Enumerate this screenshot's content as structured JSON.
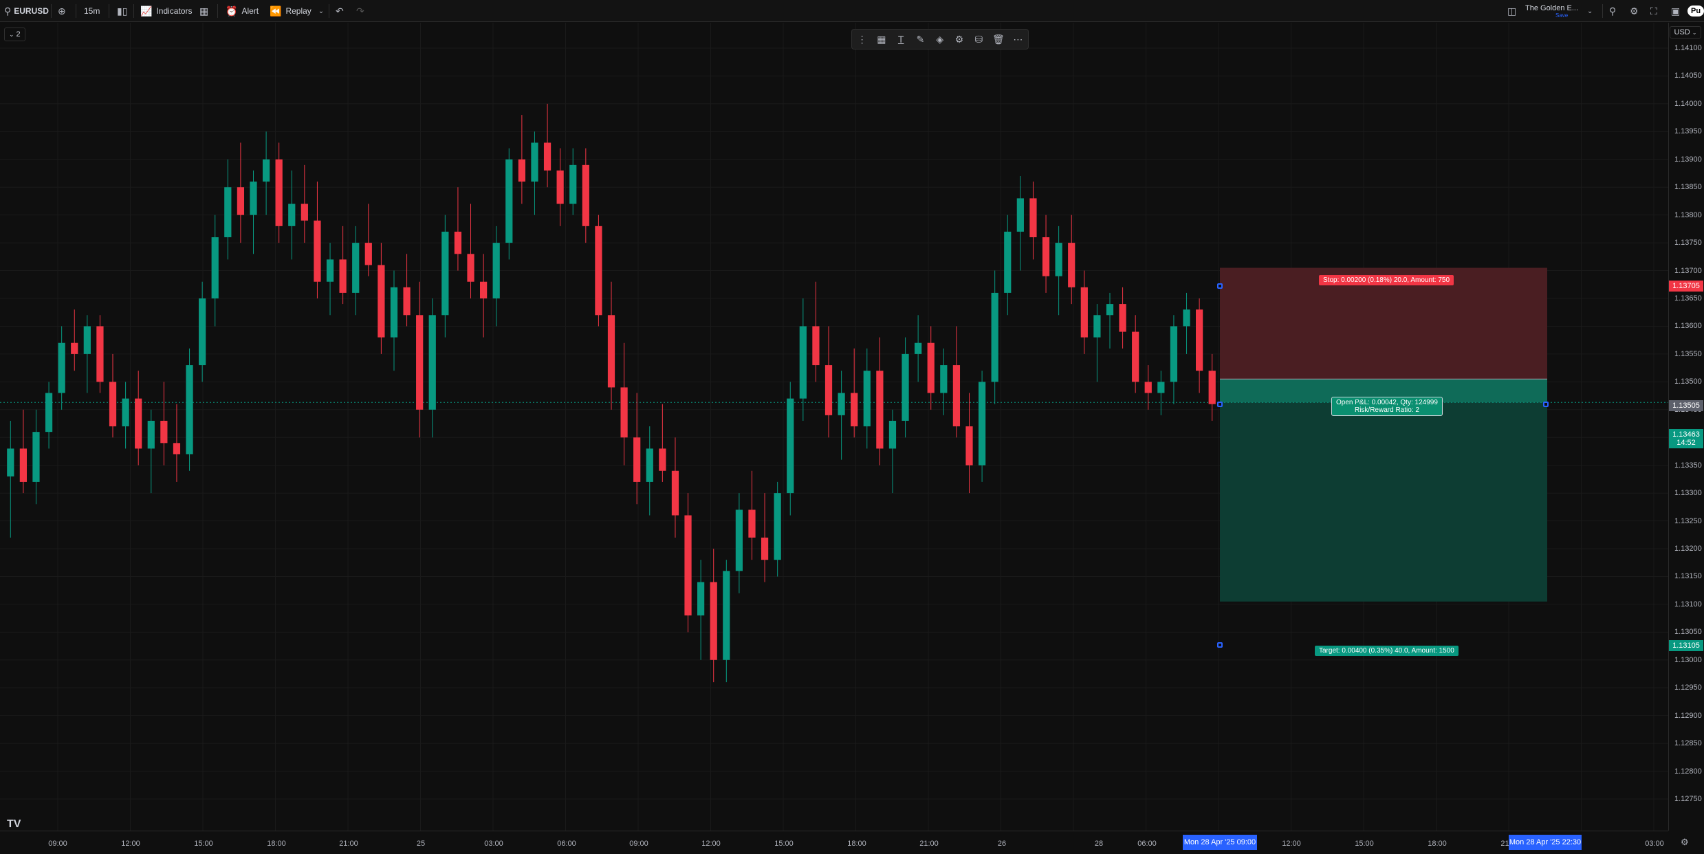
{
  "toolbar": {
    "symbol": "EURUSD",
    "interval": "15m",
    "indicators": "Indicators",
    "alert": "Alert",
    "replay": "Replay",
    "layout_name": "The Golden E...",
    "save": "Save",
    "account_badge": "Pu"
  },
  "layout_badge": "2",
  "currency": "USD",
  "floating_toolbar_icons": [
    "drag-handle-icon",
    "template-icon",
    "text-tool-icon",
    "paint-brush-icon",
    "fill-color-icon",
    "settings-icon",
    "lock-icon",
    "trash-icon",
    "more-icon"
  ],
  "price_axis": {
    "ticks": [
      "1.14100",
      "1.14050",
      "1.14000",
      "1.13950",
      "1.13900",
      "1.13850",
      "1.13800",
      "1.13750",
      "1.13700",
      "1.13650",
      "1.13600",
      "1.13550",
      "1.13500",
      "1.13450",
      "1.13400",
      "1.13350",
      "1.13300",
      "1.13250",
      "1.13200",
      "1.13150",
      "1.13100",
      "1.13050",
      "1.13000",
      "1.12950",
      "1.12900",
      "1.12850",
      "1.12800",
      "1.12750"
    ],
    "stop_label": "1.13705",
    "entry_label": "1.13505",
    "current_price": "1.13463",
    "countdown": "14:52",
    "target_label": "1.13105"
  },
  "time_axis": {
    "ticks": [
      "09:00",
      "12:00",
      "15:00",
      "18:00",
      "21:00",
      "25",
      "03:00",
      "06:00",
      "09:00",
      "12:00",
      "15:00",
      "18:00",
      "21:00",
      "26",
      "28",
      "06:00",
      "12:00",
      "15:00",
      "18:00",
      "21:",
      "03:00"
    ],
    "start_label": "Mon 28 Apr '25   09:00",
    "end_label": "Mon 28 Apr '25   22:30"
  },
  "position": {
    "stop_text": "Stop: 0.00200 (0.18%) 20.0, Amount: 750",
    "target_text": "Target: 0.00400 (0.35%) 40.0, Amount: 1500",
    "pnl_text": "Open P&L: 0.00042, Qty: 124999",
    "rr_text": "Risk/Reward Ratio: 2",
    "stop": 1.13705,
    "entry": 1.13505,
    "target": 1.13105
  },
  "colors": {
    "up": "#089981",
    "down": "#f23645",
    "stop_zone": "#4a1e22",
    "target_zone": "#0d3d33",
    "accent": "#2962ff"
  },
  "chart_data": {
    "type": "candlestick",
    "ylim": [
      1.1275,
      1.1412
    ],
    "ohlc": [
      [
        1.1333,
        1.1343,
        1.1322,
        1.1338
      ],
      [
        1.1338,
        1.1345,
        1.133,
        1.1332
      ],
      [
        1.1332,
        1.1345,
        1.1328,
        1.1341
      ],
      [
        1.1341,
        1.135,
        1.1338,
        1.1348
      ],
      [
        1.1348,
        1.136,
        1.1345,
        1.1357
      ],
      [
        1.1357,
        1.1363,
        1.1352,
        1.1355
      ],
      [
        1.1355,
        1.1362,
        1.1348,
        1.136
      ],
      [
        1.136,
        1.1362,
        1.1348,
        1.135
      ],
      [
        1.135,
        1.1355,
        1.134,
        1.1342
      ],
      [
        1.1342,
        1.135,
        1.1338,
        1.1347
      ],
      [
        1.1347,
        1.1352,
        1.1335,
        1.1338
      ],
      [
        1.1338,
        1.1345,
        1.133,
        1.1343
      ],
      [
        1.1343,
        1.135,
        1.1335,
        1.1339
      ],
      [
        1.1339,
        1.1346,
        1.1332,
        1.1337
      ],
      [
        1.1337,
        1.1356,
        1.1334,
        1.1353
      ],
      [
        1.1353,
        1.1368,
        1.135,
        1.1365
      ],
      [
        1.1365,
        1.138,
        1.136,
        1.1376
      ],
      [
        1.1376,
        1.139,
        1.1372,
        1.1385
      ],
      [
        1.1385,
        1.1393,
        1.1375,
        1.138
      ],
      [
        1.138,
        1.1388,
        1.1373,
        1.1386
      ],
      [
        1.1386,
        1.1395,
        1.138,
        1.139
      ],
      [
        1.139,
        1.1393,
        1.1375,
        1.1378
      ],
      [
        1.1378,
        1.1388,
        1.1372,
        1.1382
      ],
      [
        1.1382,
        1.1389,
        1.1375,
        1.1379
      ],
      [
        1.1379,
        1.1386,
        1.1365,
        1.1368
      ],
      [
        1.1368,
        1.1375,
        1.1362,
        1.1372
      ],
      [
        1.1372,
        1.1378,
        1.1364,
        1.1366
      ],
      [
        1.1366,
        1.1378,
        1.1362,
        1.1375
      ],
      [
        1.1375,
        1.1382,
        1.1369,
        1.1371
      ],
      [
        1.1371,
        1.1375,
        1.1355,
        1.1358
      ],
      [
        1.1358,
        1.137,
        1.1352,
        1.1367
      ],
      [
        1.1367,
        1.1373,
        1.136,
        1.1362
      ],
      [
        1.1362,
        1.1368,
        1.134,
        1.1345
      ],
      [
        1.1345,
        1.1365,
        1.134,
        1.1362
      ],
      [
        1.1362,
        1.138,
        1.1358,
        1.1377
      ],
      [
        1.1377,
        1.1385,
        1.137,
        1.1373
      ],
      [
        1.1373,
        1.1382,
        1.1365,
        1.1368
      ],
      [
        1.1368,
        1.1373,
        1.1358,
        1.1365
      ],
      [
        1.1365,
        1.1378,
        1.136,
        1.1375
      ],
      [
        1.1375,
        1.1392,
        1.1372,
        1.139
      ],
      [
        1.139,
        1.1398,
        1.1382,
        1.1386
      ],
      [
        1.1386,
        1.1395,
        1.138,
        1.1393
      ],
      [
        1.1393,
        1.14,
        1.1385,
        1.1388
      ],
      [
        1.1388,
        1.1392,
        1.1378,
        1.1382
      ],
      [
        1.1382,
        1.1392,
        1.138,
        1.1389
      ],
      [
        1.1389,
        1.1392,
        1.1375,
        1.1378
      ],
      [
        1.1378,
        1.138,
        1.136,
        1.1362
      ],
      [
        1.1362,
        1.1368,
        1.1345,
        1.1349
      ],
      [
        1.1349,
        1.1357,
        1.1335,
        1.134
      ],
      [
        1.134,
        1.1348,
        1.1328,
        1.1332
      ],
      [
        1.1332,
        1.1342,
        1.1326,
        1.1338
      ],
      [
        1.1338,
        1.1346,
        1.1332,
        1.1334
      ],
      [
        1.1334,
        1.134,
        1.1322,
        1.1326
      ],
      [
        1.1326,
        1.133,
        1.1305,
        1.1308
      ],
      [
        1.1308,
        1.1318,
        1.13,
        1.1314
      ],
      [
        1.1314,
        1.132,
        1.1296,
        1.13
      ],
      [
        1.13,
        1.1318,
        1.1296,
        1.1316
      ],
      [
        1.1316,
        1.133,
        1.1312,
        1.1327
      ],
      [
        1.1327,
        1.1334,
        1.1318,
        1.1322
      ],
      [
        1.1322,
        1.133,
        1.1314,
        1.1318
      ],
      [
        1.1318,
        1.1332,
        1.1315,
        1.133
      ],
      [
        1.133,
        1.135,
        1.1326,
        1.1347
      ],
      [
        1.1347,
        1.1365,
        1.1343,
        1.136
      ],
      [
        1.136,
        1.1368,
        1.135,
        1.1353
      ],
      [
        1.1353,
        1.136,
        1.134,
        1.1344
      ],
      [
        1.1344,
        1.1352,
        1.1336,
        1.1348
      ],
      [
        1.1348,
        1.1356,
        1.134,
        1.1342
      ],
      [
        1.1342,
        1.1356,
        1.1338,
        1.1352
      ],
      [
        1.1352,
        1.1358,
        1.1335,
        1.1338
      ],
      [
        1.1338,
        1.1345,
        1.133,
        1.1343
      ],
      [
        1.1343,
        1.1358,
        1.134,
        1.1355
      ],
      [
        1.1355,
        1.1362,
        1.135,
        1.1357
      ],
      [
        1.1357,
        1.136,
        1.1345,
        1.1348
      ],
      [
        1.1348,
        1.1356,
        1.1344,
        1.1353
      ],
      [
        1.1353,
        1.136,
        1.134,
        1.1342
      ],
      [
        1.1342,
        1.1348,
        1.133,
        1.1335
      ],
      [
        1.1335,
        1.1352,
        1.1332,
        1.135
      ],
      [
        1.135,
        1.137,
        1.1346,
        1.1366
      ],
      [
        1.1366,
        1.138,
        1.1362,
        1.1377
      ],
      [
        1.1377,
        1.1387,
        1.137,
        1.1383
      ],
      [
        1.1383,
        1.1386,
        1.1372,
        1.1376
      ],
      [
        1.1376,
        1.138,
        1.1366,
        1.1369
      ],
      [
        1.1369,
        1.1378,
        1.1362,
        1.1375
      ],
      [
        1.1375,
        1.138,
        1.1364,
        1.1367
      ],
      [
        1.1367,
        1.137,
        1.1355,
        1.1358
      ],
      [
        1.1358,
        1.1364,
        1.135,
        1.1362
      ],
      [
        1.1362,
        1.1366,
        1.1356,
        1.1364
      ],
      [
        1.1364,
        1.1367,
        1.1356,
        1.1359
      ],
      [
        1.1359,
        1.1362,
        1.1348,
        1.135
      ],
      [
        1.135,
        1.1353,
        1.1345,
        1.1348
      ],
      [
        1.1348,
        1.1352,
        1.1344,
        1.135
      ],
      [
        1.135,
        1.1362,
        1.1346,
        1.136
      ],
      [
        1.136,
        1.1366,
        1.1355,
        1.1363
      ],
      [
        1.1363,
        1.1365,
        1.1348,
        1.1352
      ],
      [
        1.1352,
        1.1355,
        1.1343,
        1.1346
      ]
    ]
  }
}
